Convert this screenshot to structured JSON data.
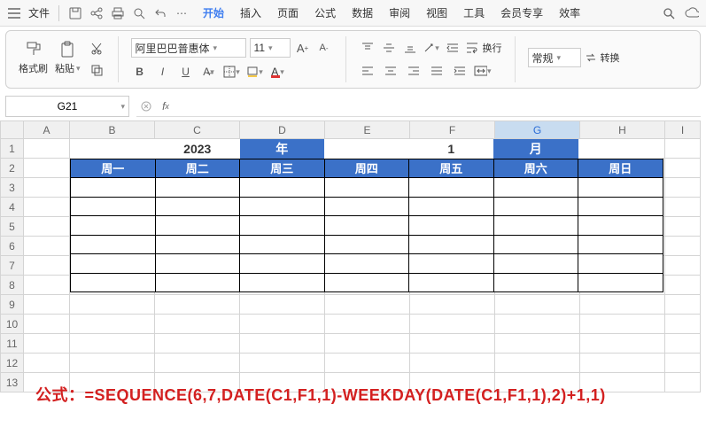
{
  "menu": {
    "file": "文件",
    "tabs": [
      "开始",
      "插入",
      "页面",
      "公式",
      "数据",
      "审阅",
      "视图",
      "工具",
      "会员专享",
      "效率"
    ],
    "active_tab_index": 0
  },
  "ribbon": {
    "format_painter": "格式刷",
    "paste": "粘贴",
    "font_name": "阿里巴巴普惠体",
    "font_size": "11",
    "bold": "B",
    "italic": "I",
    "underline": "U",
    "wrap": "换行",
    "format_combo": "常规",
    "convert": "转换"
  },
  "namebox": {
    "value": "G21"
  },
  "columns": [
    "A",
    "B",
    "C",
    "D",
    "E",
    "F",
    "G",
    "H",
    "I"
  ],
  "selected_col": "G",
  "rows": [
    1,
    2,
    3,
    4,
    5,
    6,
    7,
    8,
    9,
    10,
    11,
    12,
    13
  ],
  "calendar": {
    "year": "2023",
    "year_label": "年",
    "month": "1",
    "month_label": "月",
    "weekdays": [
      "周一",
      "周二",
      "周三",
      "周四",
      "周五",
      "周六",
      "周日"
    ]
  },
  "formula_annotation": "公式：=SEQUENCE(6,7,DATE(C1,F1,1)-WEEKDAY(DATE(C1,F1,1),2)+1,1)",
  "chart_data": {
    "type": "table",
    "title": "Calendar template",
    "header_row1": {
      "C1": "2023",
      "D1": "年",
      "F1": "1",
      "G1": "月"
    },
    "header_row2": [
      "周一",
      "周二",
      "周三",
      "周四",
      "周五",
      "周六",
      "周日"
    ],
    "body_rows": 6,
    "body_cols": 7,
    "body_values": null,
    "formula": "=SEQUENCE(6,7,DATE(C1,F1,1)-WEEKDAY(DATE(C1,F1,1),2)+1,1)"
  }
}
